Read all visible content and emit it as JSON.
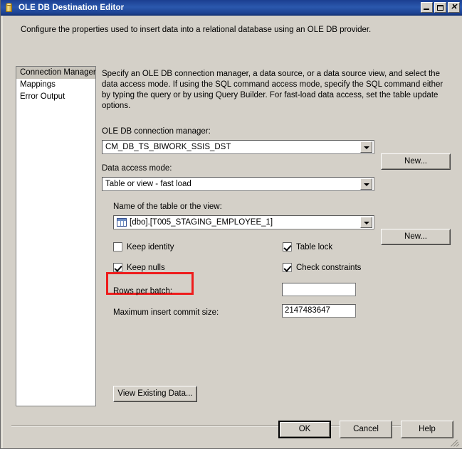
{
  "window": {
    "title": "OLE DB Destination Editor",
    "icon": "database-cylinder-icon",
    "minimize_label": "",
    "maximize_label": "",
    "close_label": "✕"
  },
  "intro": "Configure the properties used to insert data into a relational database using an OLE DB provider.",
  "sidebar": {
    "items": [
      {
        "label": "Connection Manager",
        "selected": true
      },
      {
        "label": "Mappings",
        "selected": false
      },
      {
        "label": "Error Output",
        "selected": false
      }
    ]
  },
  "main": {
    "description": "Specify an OLE DB connection manager, a data source, or a data source view, and select the data access mode. If using the SQL command access mode, specify the SQL command either by typing the query or by using Query Builder. For fast-load data access, set the table update options.",
    "connection_manager": {
      "label": "OLE DB connection manager:",
      "value": "CM_DB_TS_BIWORK_SSIS_DST",
      "new_button": "New..."
    },
    "data_access_mode": {
      "label": "Data access mode:",
      "value": "Table or view - fast load"
    },
    "table_or_view": {
      "label": "Name of the table or the view:",
      "value": "[dbo].[T005_STAGING_EMPLOYEE_1]",
      "icon": "table-icon",
      "new_button": "New..."
    },
    "options": [
      {
        "label": "Keep identity",
        "checked": false,
        "highlighted": false
      },
      {
        "label": "Keep nulls",
        "checked": true,
        "highlighted": true
      },
      {
        "label": "Table lock",
        "checked": true,
        "highlighted": false
      },
      {
        "label": "Check constraints",
        "checked": true,
        "highlighted": false
      }
    ],
    "rows_per_batch": {
      "label": "Rows per batch:",
      "value": ""
    },
    "max_insert_commit_size": {
      "label": "Maximum insert commit size:",
      "value": "2147483647"
    },
    "view_existing_data_button": "View Existing Data..."
  },
  "footer": {
    "ok": "OK",
    "cancel": "Cancel",
    "help": "Help"
  },
  "annotation": {
    "color": "#ee1c1c",
    "target": "Keep nulls"
  }
}
